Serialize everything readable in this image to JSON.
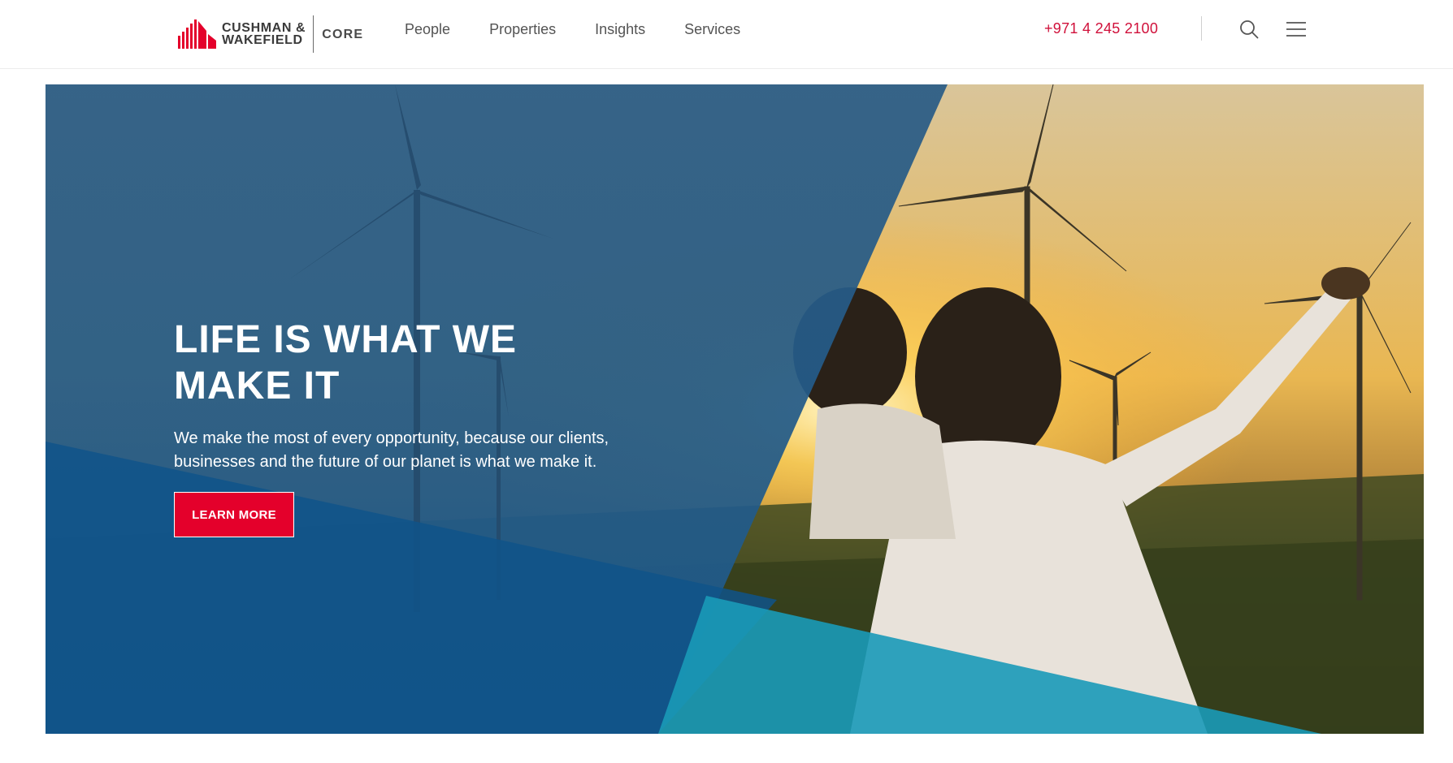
{
  "brand": {
    "name_line1": "CUSHMAN &",
    "name_line2": "WAKEFIELD",
    "division": "CORE",
    "primary_color": "#e4002b",
    "logo_icon": "cushman-wakefield-logo-icon"
  },
  "nav": {
    "items": [
      {
        "label": "People"
      },
      {
        "label": "Properties"
      },
      {
        "label": "Insights"
      },
      {
        "label": "Services"
      }
    ]
  },
  "header": {
    "phone": "+971 4 245 2100",
    "search_icon": "search-icon",
    "menu_icon": "hamburger-menu-icon"
  },
  "hero": {
    "title": "LIFE IS WHAT WE MAKE IT",
    "subtitle": "We make the most of every opportunity, because our clients, businesses and the future of our planet is what we make it.",
    "cta_label": "LEARN MORE",
    "overlay_color": "#1f5b88",
    "accent_color": "#1a9ab8"
  }
}
